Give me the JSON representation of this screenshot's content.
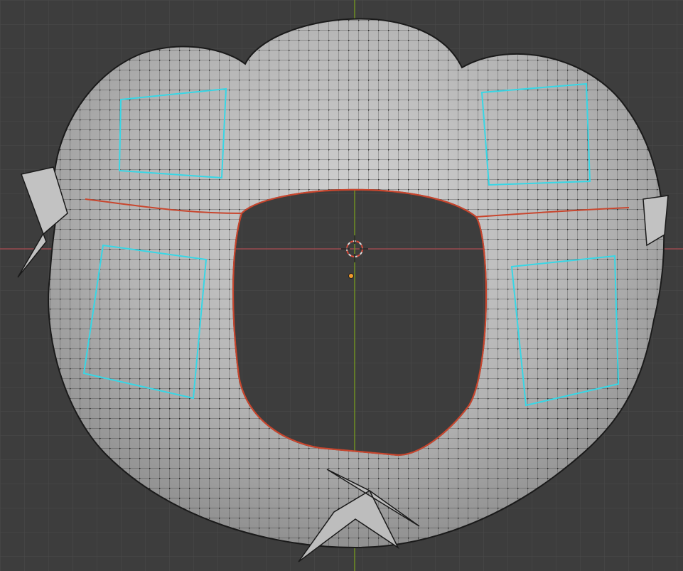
{
  "viewport": {
    "mode": "edit-mode-wireframe-over-solid",
    "background_color": "#3d3d3d",
    "grid_color": "#4a4a4a",
    "axis_x_color": "#9a4a4f",
    "axis_y_color": "#6f8f23",
    "mesh_fill_color": "#b9b9b9",
    "edge_color": "#1a1a1a",
    "seam_color": "#c8462e",
    "uv_island_color": "#37d7e6",
    "cursor_color": "#d94a3a",
    "origin_color": "#f29b2a"
  },
  "objects": [
    {
      "name": "mesh-object",
      "kind": "mesh",
      "icon": "mesh-icon"
    },
    {
      "name": "3d-cursor",
      "kind": "cursor",
      "icon": "crosshair-icon"
    },
    {
      "name": "object-origin",
      "kind": "origin",
      "icon": "dot-icon"
    }
  ]
}
